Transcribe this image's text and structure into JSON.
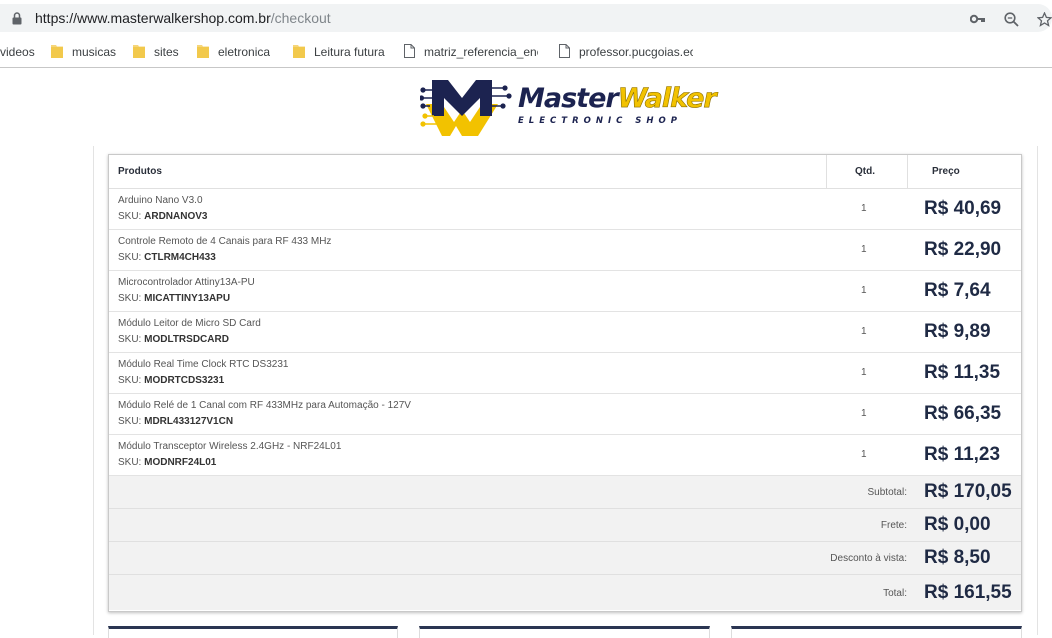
{
  "browser": {
    "url_host": "https://www.masterwalkershop.com.br",
    "url_path": "/checkout",
    "icons": [
      "lock-icon",
      "key-icon",
      "zoom-icon",
      "star-icon"
    ]
  },
  "bookmarks": [
    {
      "label": "videos",
      "icon": "none"
    },
    {
      "label": "musicas",
      "icon": "folder-icon"
    },
    {
      "label": "sites",
      "icon": "folder-icon"
    },
    {
      "label": "eletronica",
      "icon": "folder-icon"
    },
    {
      "label": "Leitura futura",
      "icon": "folder-icon"
    },
    {
      "label": "matriz_referencia_ene",
      "icon": "page-icon"
    },
    {
      "label": "professor.pucgoias.ec",
      "icon": "page-icon"
    }
  ],
  "logo": {
    "brand_master": "Master",
    "brand_walker": "Walker",
    "tagline": "ELECTRONIC SHOP"
  },
  "cart": {
    "headers": {
      "product": "Produtos",
      "qty": "Qtd.",
      "price": "Preço"
    },
    "sku_label": "SKU:",
    "items": [
      {
        "name": "Arduino Nano V3.0",
        "sku": "ARDNANOV3",
        "qty": "1",
        "price": "R$ 40,69"
      },
      {
        "name": "Controle Remoto de 4 Canais para RF 433 MHz",
        "sku": "CTLRM4CH433",
        "qty": "1",
        "price": "R$ 22,90"
      },
      {
        "name": "Microcontrolador Attiny13A-PU",
        "sku": "MICATTINY13APU",
        "qty": "1",
        "price": "R$ 7,64"
      },
      {
        "name": "Módulo Leitor de Micro SD Card",
        "sku": "MODLTRSDCARD",
        "qty": "1",
        "price": "R$ 9,89"
      },
      {
        "name": "Módulo Real Time Clock RTC DS3231",
        "sku": "MODRTCDS3231",
        "qty": "1",
        "price": "R$ 11,35"
      },
      {
        "name": "Módulo Relé de 1 Canal com RF 433MHz para Automação - 127V",
        "sku": "MDRL433127V1CN",
        "qty": "1",
        "price": "R$ 66,35"
      },
      {
        "name": "Módulo Transceptor Wireless 2.4GHz - NRF24L01",
        "sku": "MODNRF24L01",
        "qty": "1",
        "price": "R$ 11,23"
      }
    ],
    "totals": [
      {
        "label": "Subtotal:",
        "value": "R$ 170,05"
      },
      {
        "label": "Frete:",
        "value": "R$ 0,00"
      },
      {
        "label": "Desconto à vista:",
        "value": "R$ 8,50"
      },
      {
        "label": "Total:",
        "value": "R$ 161,55"
      }
    ]
  },
  "colors": {
    "price": "#1f2a44",
    "logo_navy": "#1c2350",
    "logo_yellow": "#f2c200"
  }
}
